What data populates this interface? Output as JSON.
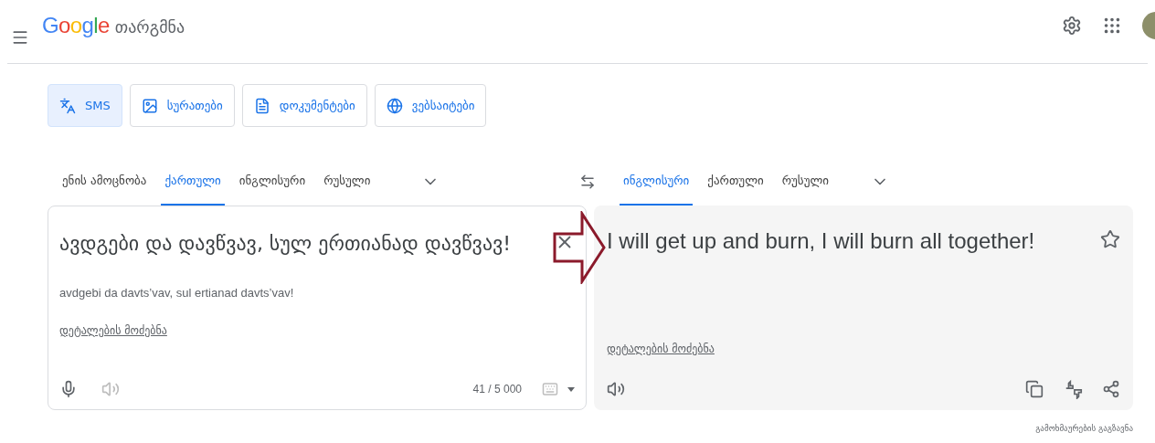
{
  "header": {
    "logo": "Google",
    "product": "თარგმნა"
  },
  "modes": [
    {
      "kind": "text",
      "label": "SMS",
      "selected": true
    },
    {
      "kind": "images",
      "label": "სურათები",
      "selected": false
    },
    {
      "kind": "documents",
      "label": "დოკუმენტები",
      "selected": false
    },
    {
      "kind": "websites",
      "label": "ვებსაიტები",
      "selected": false
    }
  ],
  "source_languages": [
    {
      "label": "ენის ამოცნობა",
      "selected": false
    },
    {
      "label": "ქართული",
      "selected": true
    },
    {
      "label": "ინგლისური",
      "selected": false
    },
    {
      "label": "რუსული",
      "selected": false
    }
  ],
  "target_languages": [
    {
      "label": "ინგლისური",
      "selected": true
    },
    {
      "label": "ქართული",
      "selected": false
    },
    {
      "label": "რუსული",
      "selected": false
    }
  ],
  "source": {
    "text": "ავდგები და დავწვავ, სულ ერთიანად დავწვავ!",
    "transliteration": "avdgebi da davts’vav, sul ertianad davts’vav!",
    "details_link": "დეტალების მოძებნა",
    "char_count": "41 / 5 000"
  },
  "target": {
    "text": "I will get up and burn, I will burn all together!",
    "details_link": "დეტალების მოძებნა",
    "starred": false
  },
  "feedback": "გამოხმაურების გაგზავნა"
}
